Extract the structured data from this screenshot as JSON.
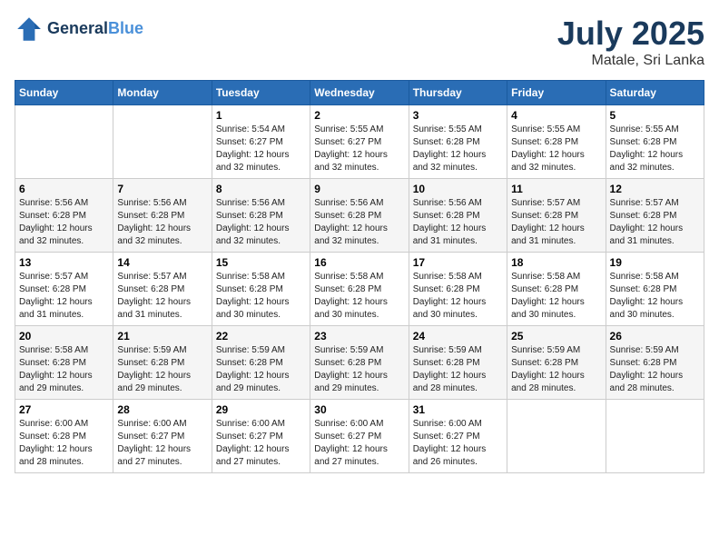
{
  "header": {
    "logo_line1": "General",
    "logo_line2": "Blue",
    "month": "July 2025",
    "location": "Matale, Sri Lanka"
  },
  "weekdays": [
    "Sunday",
    "Monday",
    "Tuesday",
    "Wednesday",
    "Thursday",
    "Friday",
    "Saturday"
  ],
  "weeks": [
    [
      {
        "day": "",
        "info": ""
      },
      {
        "day": "",
        "info": ""
      },
      {
        "day": "1",
        "info": "Sunrise: 5:54 AM\nSunset: 6:27 PM\nDaylight: 12 hours and 32 minutes."
      },
      {
        "day": "2",
        "info": "Sunrise: 5:55 AM\nSunset: 6:27 PM\nDaylight: 12 hours and 32 minutes."
      },
      {
        "day": "3",
        "info": "Sunrise: 5:55 AM\nSunset: 6:28 PM\nDaylight: 12 hours and 32 minutes."
      },
      {
        "day": "4",
        "info": "Sunrise: 5:55 AM\nSunset: 6:28 PM\nDaylight: 12 hours and 32 minutes."
      },
      {
        "day": "5",
        "info": "Sunrise: 5:55 AM\nSunset: 6:28 PM\nDaylight: 12 hours and 32 minutes."
      }
    ],
    [
      {
        "day": "6",
        "info": "Sunrise: 5:56 AM\nSunset: 6:28 PM\nDaylight: 12 hours and 32 minutes."
      },
      {
        "day": "7",
        "info": "Sunrise: 5:56 AM\nSunset: 6:28 PM\nDaylight: 12 hours and 32 minutes."
      },
      {
        "day": "8",
        "info": "Sunrise: 5:56 AM\nSunset: 6:28 PM\nDaylight: 12 hours and 32 minutes."
      },
      {
        "day": "9",
        "info": "Sunrise: 5:56 AM\nSunset: 6:28 PM\nDaylight: 12 hours and 32 minutes."
      },
      {
        "day": "10",
        "info": "Sunrise: 5:56 AM\nSunset: 6:28 PM\nDaylight: 12 hours and 31 minutes."
      },
      {
        "day": "11",
        "info": "Sunrise: 5:57 AM\nSunset: 6:28 PM\nDaylight: 12 hours and 31 minutes."
      },
      {
        "day": "12",
        "info": "Sunrise: 5:57 AM\nSunset: 6:28 PM\nDaylight: 12 hours and 31 minutes."
      }
    ],
    [
      {
        "day": "13",
        "info": "Sunrise: 5:57 AM\nSunset: 6:28 PM\nDaylight: 12 hours and 31 minutes."
      },
      {
        "day": "14",
        "info": "Sunrise: 5:57 AM\nSunset: 6:28 PM\nDaylight: 12 hours and 31 minutes."
      },
      {
        "day": "15",
        "info": "Sunrise: 5:58 AM\nSunset: 6:28 PM\nDaylight: 12 hours and 30 minutes."
      },
      {
        "day": "16",
        "info": "Sunrise: 5:58 AM\nSunset: 6:28 PM\nDaylight: 12 hours and 30 minutes."
      },
      {
        "day": "17",
        "info": "Sunrise: 5:58 AM\nSunset: 6:28 PM\nDaylight: 12 hours and 30 minutes."
      },
      {
        "day": "18",
        "info": "Sunrise: 5:58 AM\nSunset: 6:28 PM\nDaylight: 12 hours and 30 minutes."
      },
      {
        "day": "19",
        "info": "Sunrise: 5:58 AM\nSunset: 6:28 PM\nDaylight: 12 hours and 30 minutes."
      }
    ],
    [
      {
        "day": "20",
        "info": "Sunrise: 5:58 AM\nSunset: 6:28 PM\nDaylight: 12 hours and 29 minutes."
      },
      {
        "day": "21",
        "info": "Sunrise: 5:59 AM\nSunset: 6:28 PM\nDaylight: 12 hours and 29 minutes."
      },
      {
        "day": "22",
        "info": "Sunrise: 5:59 AM\nSunset: 6:28 PM\nDaylight: 12 hours and 29 minutes."
      },
      {
        "day": "23",
        "info": "Sunrise: 5:59 AM\nSunset: 6:28 PM\nDaylight: 12 hours and 29 minutes."
      },
      {
        "day": "24",
        "info": "Sunrise: 5:59 AM\nSunset: 6:28 PM\nDaylight: 12 hours and 28 minutes."
      },
      {
        "day": "25",
        "info": "Sunrise: 5:59 AM\nSunset: 6:28 PM\nDaylight: 12 hours and 28 minutes."
      },
      {
        "day": "26",
        "info": "Sunrise: 5:59 AM\nSunset: 6:28 PM\nDaylight: 12 hours and 28 minutes."
      }
    ],
    [
      {
        "day": "27",
        "info": "Sunrise: 6:00 AM\nSunset: 6:28 PM\nDaylight: 12 hours and 28 minutes."
      },
      {
        "day": "28",
        "info": "Sunrise: 6:00 AM\nSunset: 6:27 PM\nDaylight: 12 hours and 27 minutes."
      },
      {
        "day": "29",
        "info": "Sunrise: 6:00 AM\nSunset: 6:27 PM\nDaylight: 12 hours and 27 minutes."
      },
      {
        "day": "30",
        "info": "Sunrise: 6:00 AM\nSunset: 6:27 PM\nDaylight: 12 hours and 27 minutes."
      },
      {
        "day": "31",
        "info": "Sunrise: 6:00 AM\nSunset: 6:27 PM\nDaylight: 12 hours and 26 minutes."
      },
      {
        "day": "",
        "info": ""
      },
      {
        "day": "",
        "info": ""
      }
    ]
  ]
}
